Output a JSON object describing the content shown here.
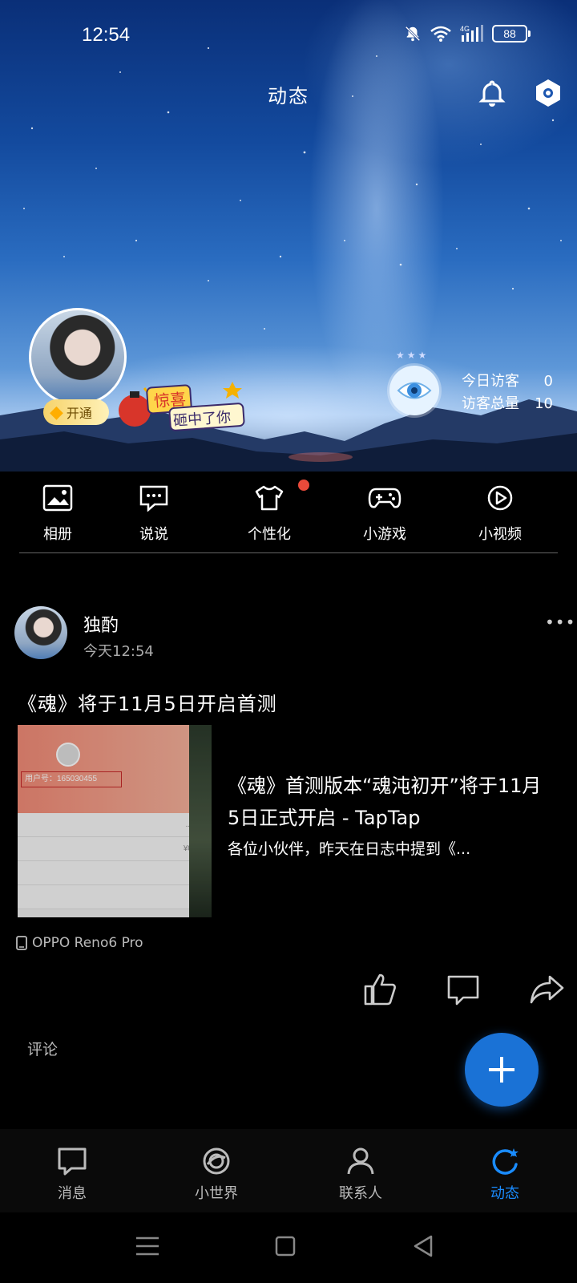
{
  "status_bar": {
    "time": "12:54",
    "battery": "88"
  },
  "header": {
    "title": "动态"
  },
  "profile": {
    "vip_label": "开通",
    "promo_line1": "惊喜",
    "promo_line2": "砸中了你"
  },
  "visitors": {
    "today_label": "今日访客",
    "today_value": "0",
    "total_label": "访客总量",
    "total_value": "10"
  },
  "features": [
    {
      "label": "相册",
      "icon": "photo-album-icon"
    },
    {
      "label": "说说",
      "icon": "chat-bubble-icon"
    },
    {
      "label": "个性化",
      "icon": "tshirt-icon"
    },
    {
      "label": "小游戏",
      "icon": "gamepad-icon"
    },
    {
      "label": "小视频",
      "icon": "play-video-icon"
    }
  ],
  "post": {
    "author": "独酌",
    "time": "今天12:54",
    "text": "《魂》将于11月5日开启首测",
    "thumbnail": {
      "uid": "用户号：165030455",
      "row1": "...",
      "row2": "¥0"
    },
    "link_title": "《魂》首测版本“魂沌初开”将于11月5日正式开启 - TapTap",
    "link_desc": "各位小伙伴，昨天在日志中提到《...",
    "device": "OPPO Reno6 Pro",
    "comment_label": "评论"
  },
  "bottom_nav": [
    {
      "label": "消息",
      "icon": "message-icon",
      "active": false
    },
    {
      "label": "小世界",
      "icon": "planet-icon",
      "active": false
    },
    {
      "label": "联系人",
      "icon": "person-icon",
      "active": false
    },
    {
      "label": "动态",
      "icon": "refresh-star-icon",
      "active": true
    }
  ],
  "colors": {
    "accent": "#1a72d6",
    "active_nav": "#1a8cff",
    "notification_dot": "#e94a3a"
  }
}
